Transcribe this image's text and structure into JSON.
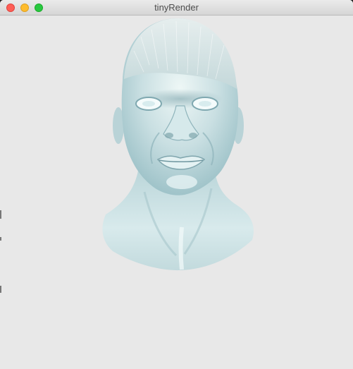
{
  "window": {
    "title": "tinyRender"
  },
  "traffic_lights": {
    "close_color": "#fe5f57",
    "minimize_color": "#febc2e",
    "zoom_color": "#28c840"
  },
  "canvas": {
    "background": "#e8e8e8",
    "subject": "head-render-icon"
  }
}
